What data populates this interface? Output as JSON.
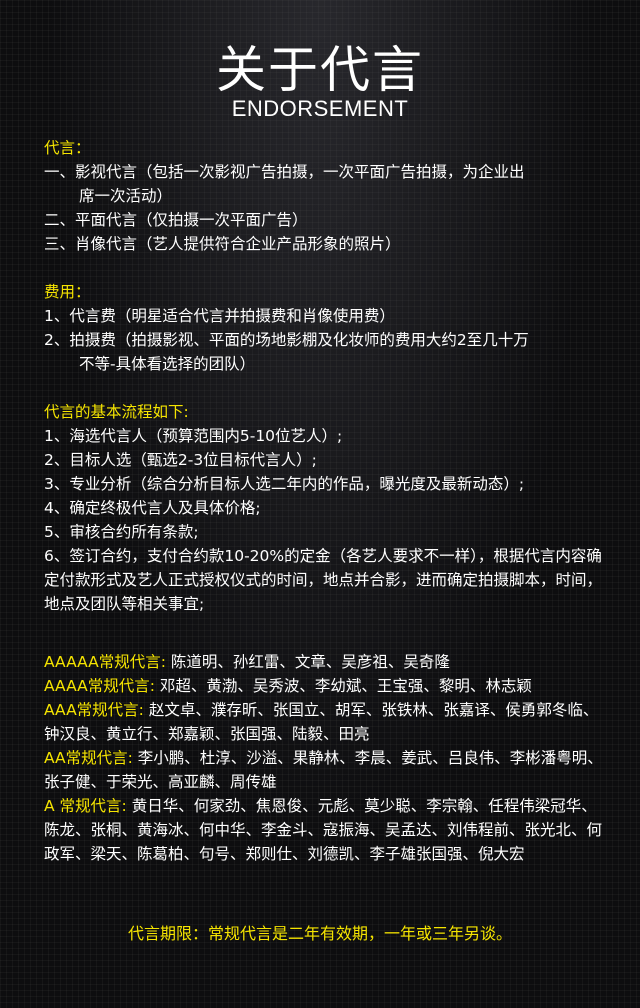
{
  "title": "关于代言",
  "subtitle": "ENDORSEMENT",
  "types": {
    "heading": "代言：",
    "items": [
      "一、影视代言（包括一次影视广告拍摄，一次平面广告拍摄，为企业出",
      "席一次活动）",
      "二、平面代言（仅拍摄一次平面广告）",
      "三、肖像代言（艺人提供符合企业产品形象的照片）"
    ]
  },
  "fees": {
    "heading": "费用：",
    "items": [
      "1、代言费（明星适合代言并拍摄费和肖像使用费）",
      "2、拍摄费（拍摄影视、平面的场地影棚及化妆师的费用大约2至几十万",
      "不等-具体看选择的团队）"
    ]
  },
  "process": {
    "heading": "代言的基本流程如下:",
    "items": [
      "1、海选代言人（预算范围内5-10位艺人）;",
      "2、目标人选（甄选2-3位目标代言人）;",
      "3、专业分析（综合分析目标人选二年内的作品，曝光度及最新动态）;",
      "4、确定终极代言人及具体价格;",
      "5、审核合约所有条款;",
      "6、签订合约，支付合约款10-20%的定金（各艺人要求不一样），根据代言内容确定付款形式及艺人正式授权仪式的时间，地点并合影，进而确定拍摄脚本，时间，地点及团队等相关事宜;"
    ]
  },
  "tiers": [
    {
      "label": "AAAAA常规代言:",
      "names": "  陈道明、孙红雷、文章、吴彦祖、吴奇隆"
    },
    {
      "label": "AAAA常规代言:",
      "names": " 邓超、黄渤、吴秀波、李幼斌、王宝强、黎明、林志颖"
    },
    {
      "label": "AAA常规代言:",
      "names": " 赵文卓、濮存昕、张国立、胡军、张铁林、张嘉译、侯勇郭冬临、钟汉良、黄立行、郑嘉颖、张国强、陆毅、田亮"
    },
    {
      "label": "AA常规代言:",
      "names": " 李小鹏、杜淳、沙溢、果静林、李晨、姜武、吕良伟、李彬潘粤明、张子健、于荣光、高亚麟、周传雄"
    },
    {
      "label": "A 常规代言:",
      "names": " 黄日华、何家劲、焦恩俊、元彪、莫少聪、李宗翰、任程伟梁冠华、陈龙、张桐、黄海冰、何中华、李金斗、寇振海、吴孟达、刘伟程前、张光北、何政军、梁天、陈葛柏、句号、郑则仕、刘德凯、李子雄张国强、倪大宏"
    }
  ],
  "footer": "代言期限：常规代言是二年有效期，一年或三年另谈。"
}
